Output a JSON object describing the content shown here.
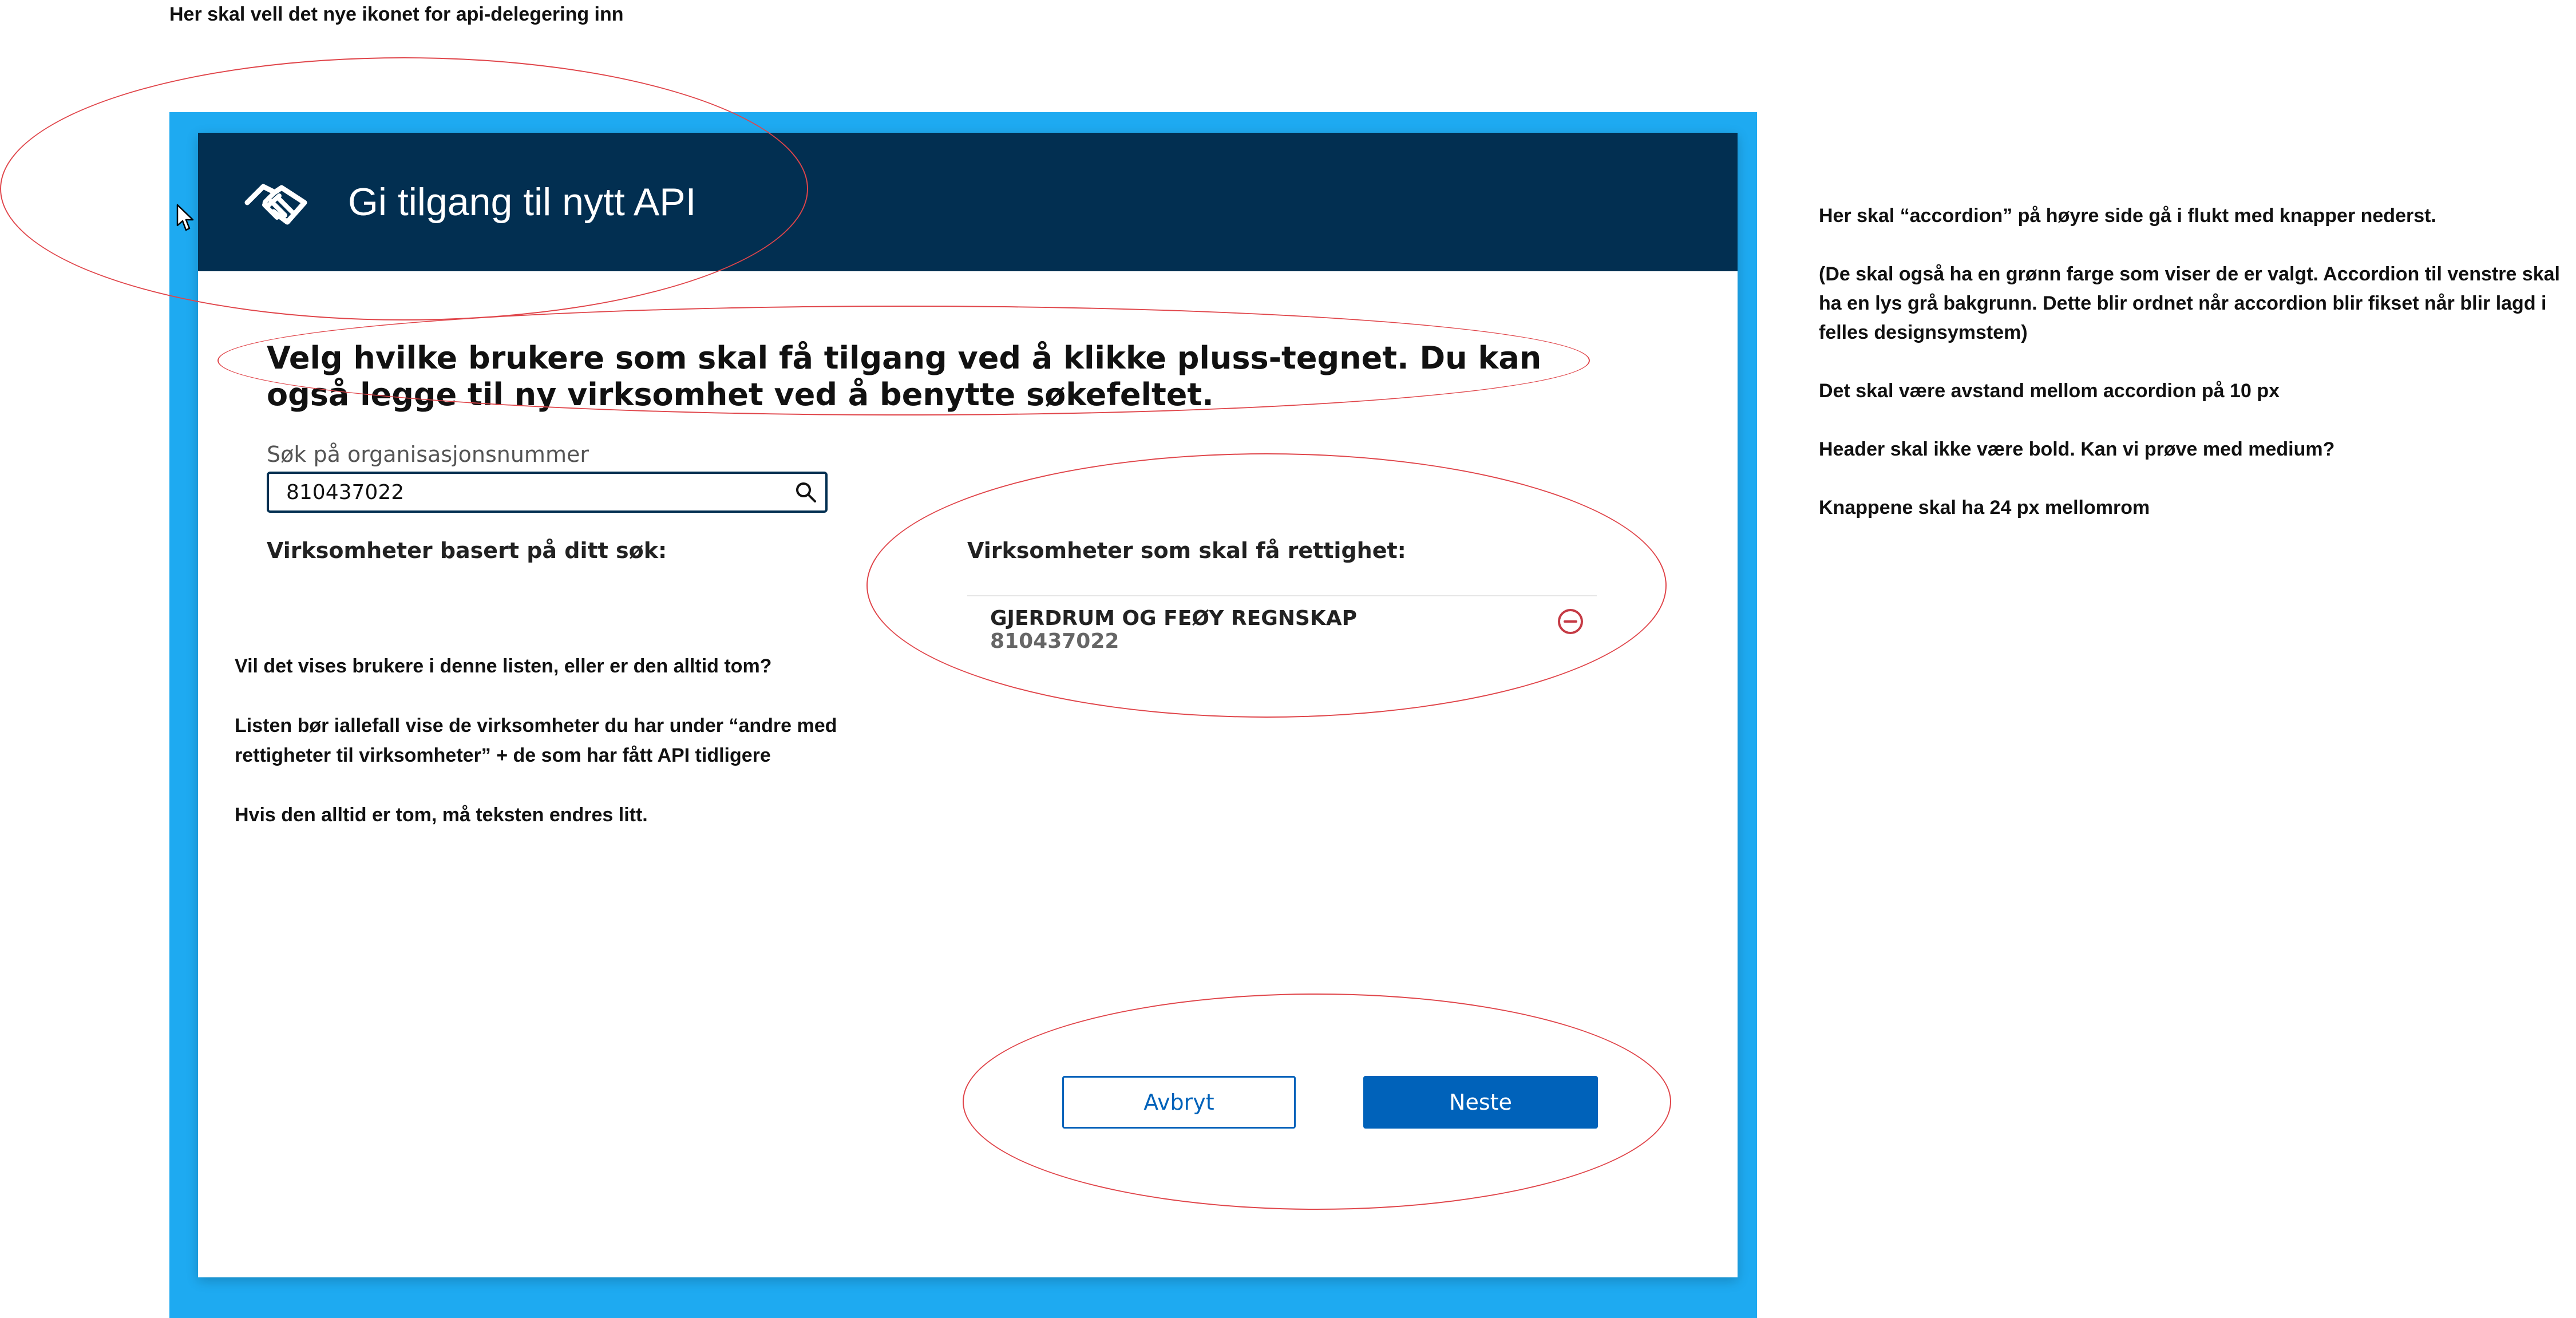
{
  "notes": {
    "top": "Her skal vell det nye ikonet for api-delegering inn",
    "left": [
      "Vil det vises brukere i denne listen, eller er den alltid tom?",
      "Listen bør iallefall vise de virksomheter du har under “andre med rettigheter til virksomheter” + de som har fått API tidligere",
      "Hvis den alltid er tom, må teksten endres litt."
    ],
    "right": [
      "Her skal “accordion” på høyre side gå i flukt med knapper nederst.",
      "(De skal også ha en grønn farge som viser de er valgt. Accordion til venstre skal ha en lys grå bakgrunn. Dette blir ordnet når accordion blir fikset når blir lagd i felles designsymstem)",
      "Det skal være avstand mellom accordion på 10 px",
      "Header skal ikke være bold. Kan vi prøve med medium?",
      "Knappene skal ha 24 px mellomrom"
    ]
  },
  "dialog": {
    "title": "Gi tilgang til nytt API",
    "header_icon": "handshake-icon",
    "instruction": "Velg hvilke brukere som skal få tilgang ved å klikke pluss-tegnet. Du kan også legge til ny virksomhet ved å benytte søkefeltet.",
    "search": {
      "label": "Søk på organisasjonsnummer",
      "value": "810437022",
      "icon": "search-icon"
    },
    "left_column": {
      "heading": "Virksomheter basert på ditt søk:"
    },
    "right_column": {
      "heading": "Virksomheter som skal få rettighet:",
      "items": [
        {
          "name": "GJERDRUM OG FEØY REGNSKAP",
          "org_number": "810437022",
          "action_icon": "remove-circle-icon"
        }
      ]
    },
    "buttons": {
      "cancel": "Avbryt",
      "next": "Neste"
    }
  },
  "colors": {
    "backdrop": "#1eaaf1",
    "header": "#022f51",
    "primary": "#0062ba",
    "remove": "#c53a44",
    "annotation": "#e0454a"
  }
}
